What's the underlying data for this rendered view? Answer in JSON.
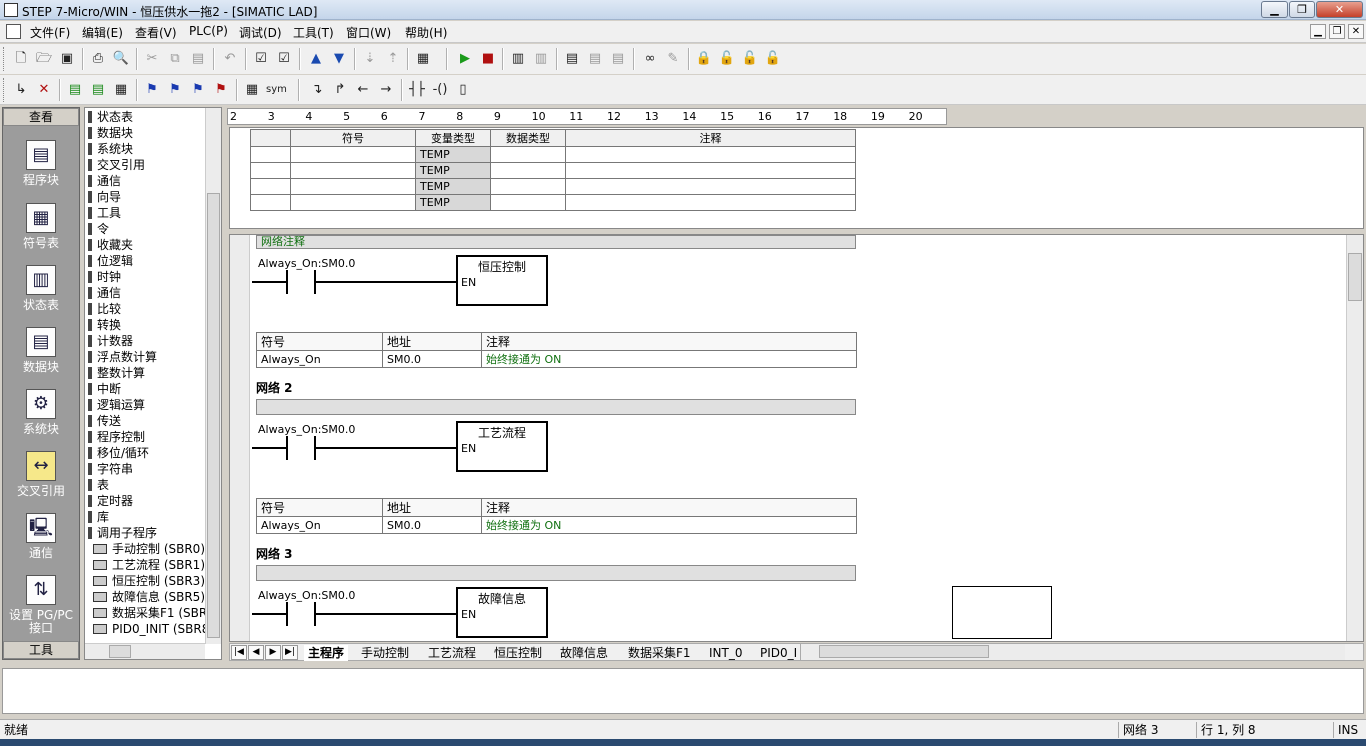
{
  "window": {
    "title": "STEP 7-Micro/WIN - 恒压供水一拖2 - [SIMATIC LAD]"
  },
  "menubar": [
    "文件(F)",
    "编辑(E)",
    "查看(V)",
    "PLC(P)",
    "调试(D)",
    "工具(T)",
    "窗口(W)",
    "帮助(H)"
  ],
  "navbar": {
    "header": "查看",
    "footer": "工具",
    "items": [
      "程序块",
      "符号表",
      "状态表",
      "数据块",
      "系统块",
      "交叉引用",
      "通信",
      "设置 PG/PC 接口"
    ]
  },
  "tree": {
    "items": [
      "状态表",
      "数据块",
      "系统块",
      "交叉引用",
      "通信",
      "向导",
      "工具",
      "令",
      "收藏夹",
      "位逻辑",
      "时钟",
      "通信",
      "比较",
      "转换",
      "计数器",
      "浮点数计算",
      "整数计算",
      "中断",
      "逻辑运算",
      "传送",
      "程序控制",
      "移位/循环",
      "字符串",
      "表",
      "定时器",
      "库",
      "调用子程序"
    ],
    "subroutines": [
      "手动控制 (SBR0)",
      "工艺流程 (SBR1)",
      "恒压控制 (SBR3)",
      "故障信息 (SBR5)",
      "数据采集F1 (SBR6",
      "PID0_INIT (SBR8)"
    ]
  },
  "ruler": [
    "2",
    "3",
    "4",
    "5",
    "6",
    "7",
    "8",
    "9",
    "10",
    "11",
    "12",
    "13",
    "14",
    "15",
    "16",
    "17",
    "18",
    "19",
    "20"
  ],
  "vartable": {
    "headers": [
      "符号",
      "变量类型",
      "数据类型",
      "注释"
    ],
    "rows": [
      "TEMP",
      "TEMP",
      "TEMP",
      "TEMP"
    ]
  },
  "networks": [
    {
      "title": "",
      "comment": "网络注释",
      "contact": "Always_On:SM0.0",
      "block": "恒压控制",
      "en": "EN",
      "sym": {
        "h": [
          "符号",
          "地址",
          "注释"
        ],
        "r": [
          "Always_On",
          "SM0.0",
          "始终接通为 ON"
        ]
      }
    },
    {
      "title": "网络 2",
      "comment": "",
      "contact": "Always_On:SM0.0",
      "block": "工艺流程",
      "en": "EN",
      "sym": {
        "h": [
          "符号",
          "地址",
          "注释"
        ],
        "r": [
          "Always_On",
          "SM0.0",
          "始终接通为 ON"
        ]
      }
    },
    {
      "title": "网络 3",
      "comment": "",
      "contact": "Always_On:SM0.0",
      "block": "故障信息",
      "en": "EN"
    }
  ],
  "tabs": [
    "主程序",
    "手动控制",
    "工艺流程",
    "恒压控制",
    "故障信息",
    "数据采集F1",
    "INT_0",
    "PID0_I"
  ],
  "status": {
    "ready": "就绪",
    "network": "网络 3",
    "position": "行 1, 列 8",
    "mode": "INS"
  }
}
